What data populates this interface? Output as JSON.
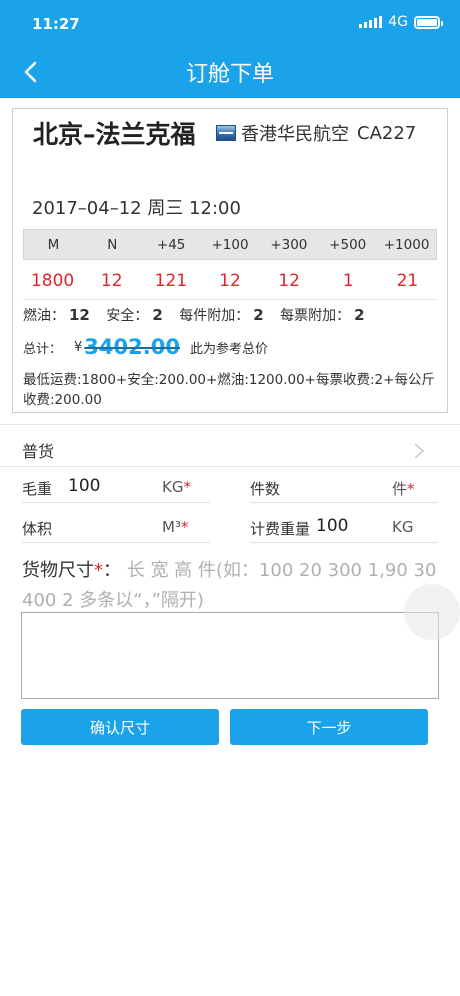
{
  "status_bar": {
    "time": "11:27",
    "network": "4G"
  },
  "nav": {
    "title": "订舱下单"
  },
  "flight": {
    "route": "北京–法兰克福",
    "airline": "香港华民航空",
    "flight_no": "CA227",
    "datetime": "2017–04–12 周三 12:00"
  },
  "rates": {
    "headers": [
      "M",
      "N",
      "+45",
      "+100",
      "+300",
      "+500",
      "+1000"
    ],
    "values": [
      "1800",
      "12",
      "121",
      "12",
      "12",
      "1",
      "21"
    ]
  },
  "fees": {
    "fuel_label": "燃油：",
    "fuel": "12",
    "security_label": "安全：",
    "security": "2",
    "per_piece_label": "每件附加：",
    "per_piece": "2",
    "per_ticket_label": "每票附加：",
    "per_ticket": "2"
  },
  "total": {
    "label": "总计：",
    "currency": "¥",
    "amount": "3402.00",
    "note": "此为参考总价",
    "formula": "最低运费:1800+安全:200.00+燃油:1200.00+每票收费:2+每公斤收费:200.00"
  },
  "form": {
    "cargo_type": "普货",
    "gross_weight_label": "毛重",
    "gross_weight": "100",
    "gross_weight_unit": "KG",
    "pieces_label": "件数",
    "pieces": "",
    "pieces_unit": "件",
    "volume_label": "体积",
    "volume": "",
    "volume_unit": "M³",
    "charge_weight_label": "计费重量",
    "charge_weight": "100",
    "charge_weight_unit": "KG",
    "dimensions_label": "货物尺寸",
    "required_mark": "*",
    "dimensions_hint": "长 宽 高 件(如：100 20 300 1,90 30 400 2 多条以“，”隔开)",
    "dimensions_value": ""
  },
  "buttons": {
    "confirm": "确认尺寸",
    "next": "下一步"
  }
}
